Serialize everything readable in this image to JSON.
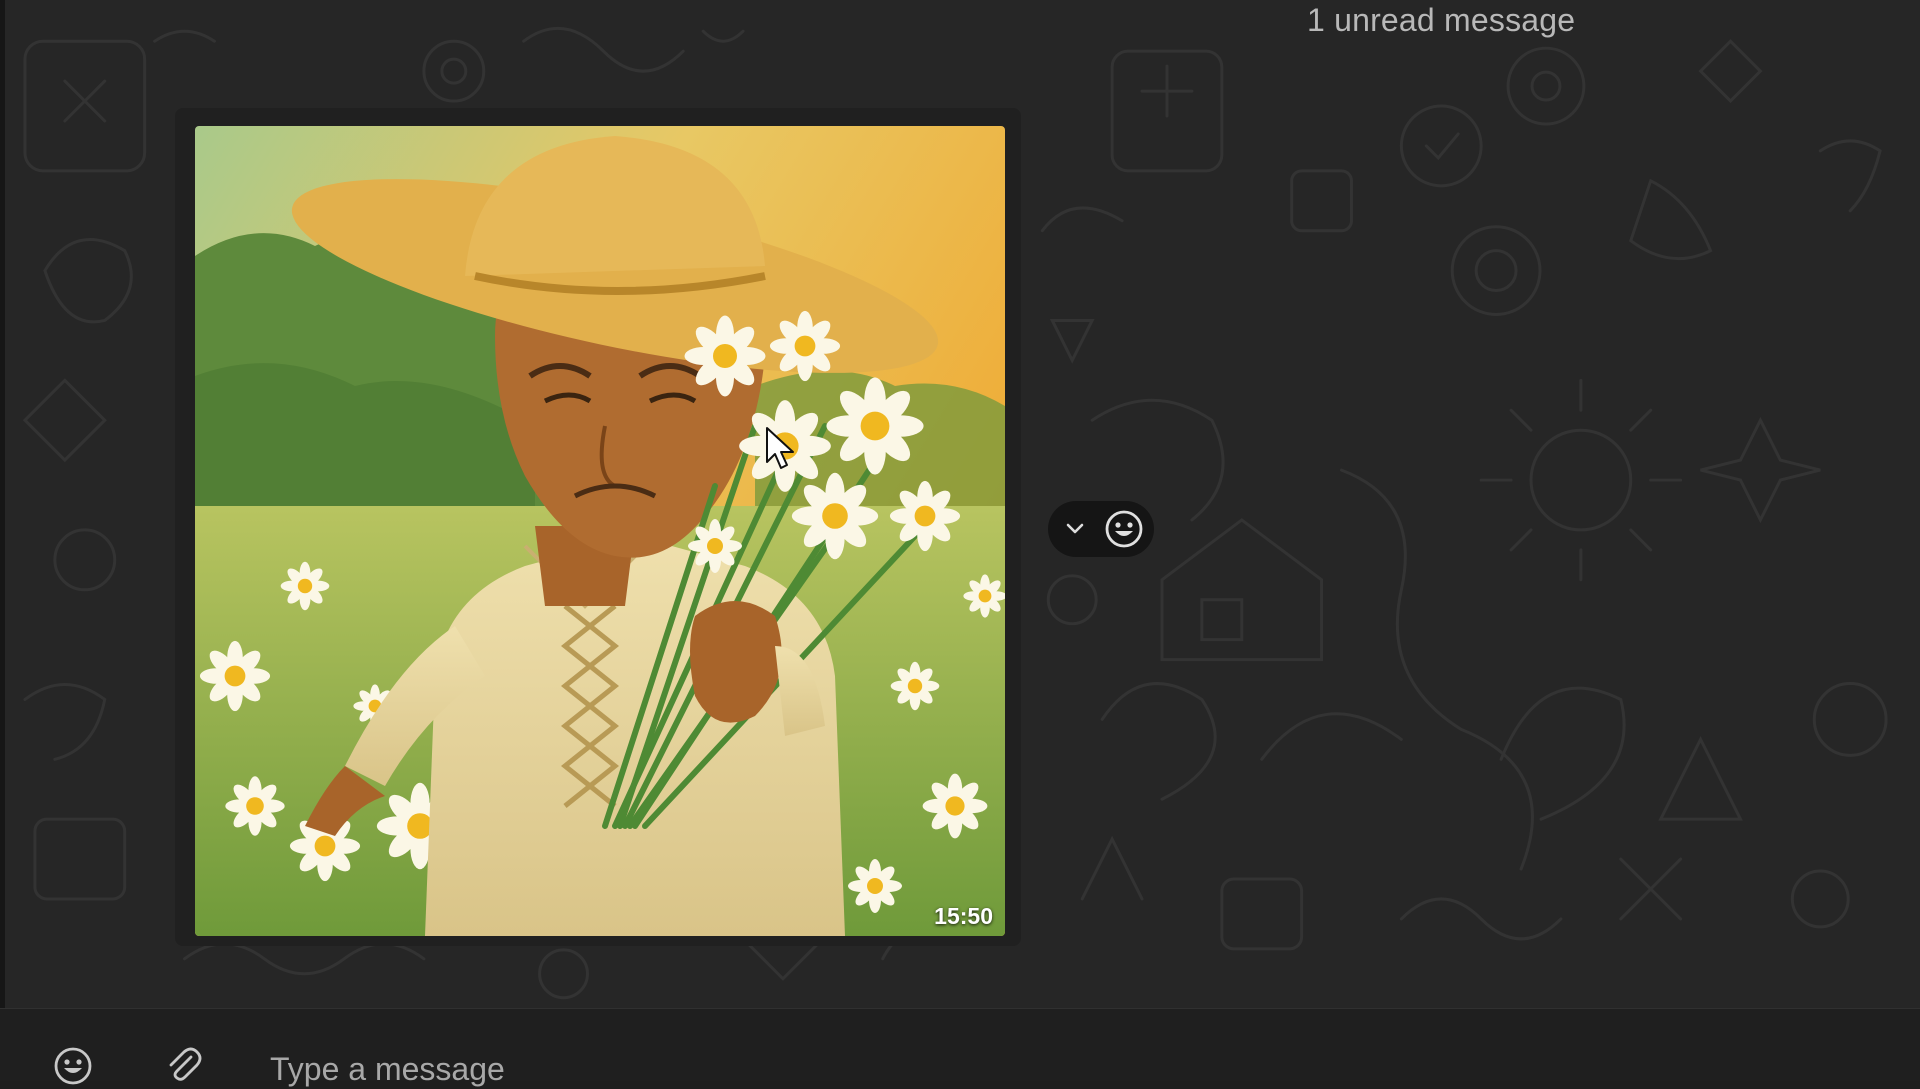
{
  "banner": {
    "unread_text": "1 unread message"
  },
  "message": {
    "time": "15:50",
    "image_alt": "Illustration of an elderly man in a straw hat holding a bouquet of daisies in a flower field"
  },
  "icons": {
    "expand": "chevron-down-icon",
    "react": "emoji-smile-icon",
    "composer_emoji": "emoji-smile-icon",
    "attach": "paperclip-icon"
  },
  "composer": {
    "placeholder": "Type a message",
    "value": ""
  },
  "colors": {
    "chat_background": "#262626",
    "bubble_background": "#202020",
    "composer_background": "#1f1f1f",
    "pill_background": "#151515",
    "text_muted": "#a8a8a8"
  }
}
